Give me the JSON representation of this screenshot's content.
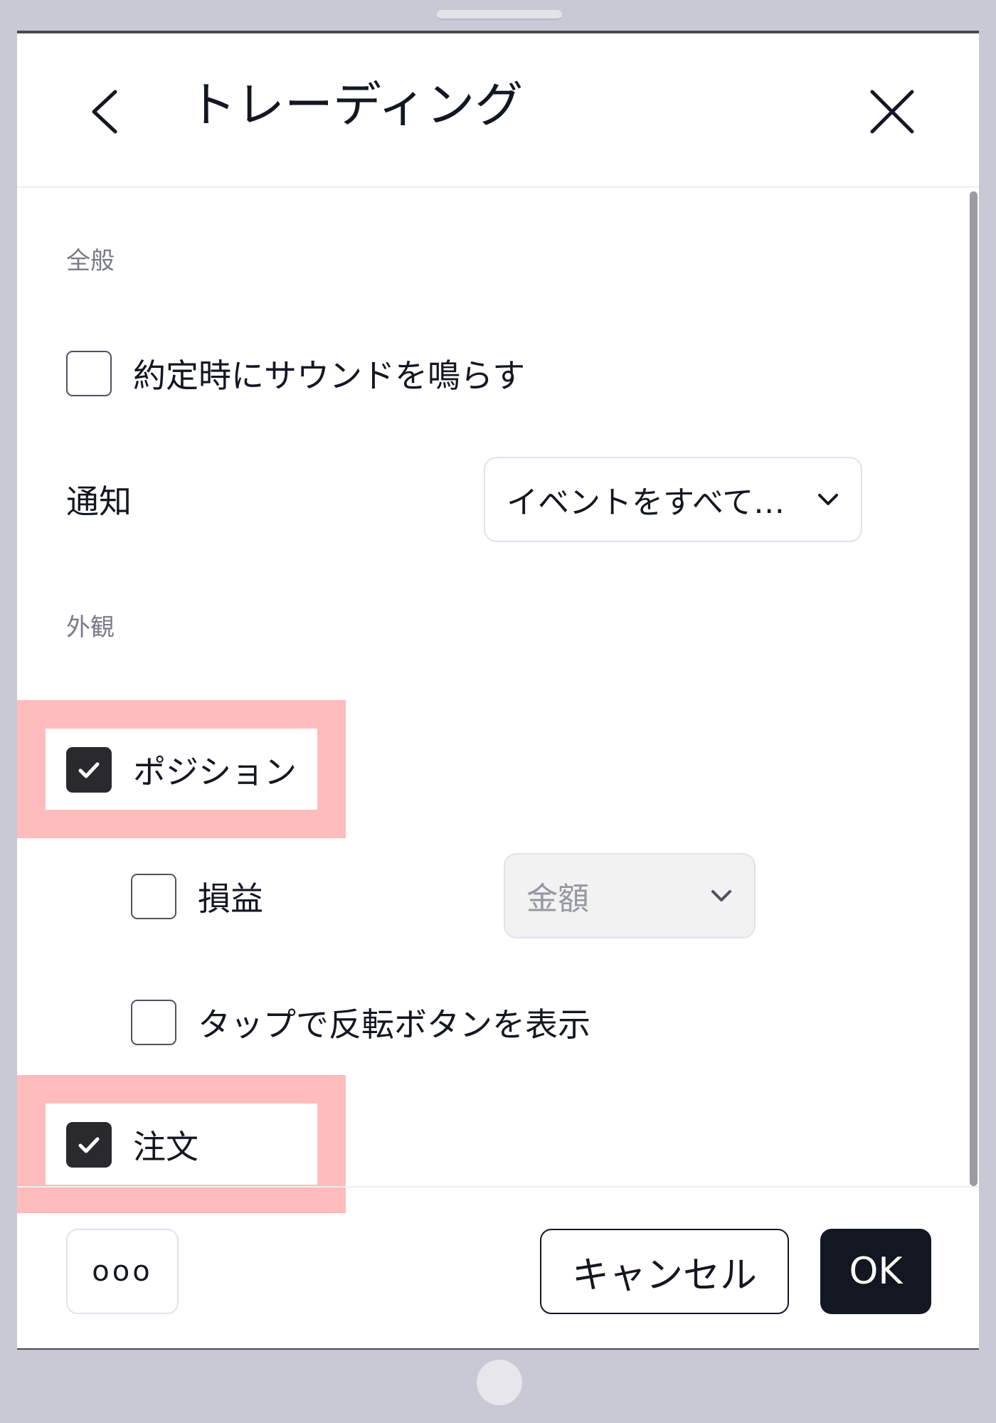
{
  "dialog": {
    "title": "トレーディング"
  },
  "general": {
    "label": "全般",
    "sound_on_fill": {
      "label": "約定時にサウンドを鳴らす",
      "checked": false
    },
    "notifications": {
      "label": "通知",
      "selected": "イベントをすべて…"
    }
  },
  "appearance": {
    "label": "外観",
    "positions": {
      "label": "ポジション",
      "checked": true
    },
    "pnl": {
      "label": "損益",
      "checked": false,
      "selected": "金額"
    },
    "reverse_button": {
      "label": "タップで反転ボタンを表示",
      "checked": false
    },
    "orders": {
      "label": "注文",
      "checked": true
    }
  },
  "footer": {
    "more_label": "ooo",
    "cancel_label": "キャンセル",
    "ok_label": "OK"
  },
  "colors": {
    "highlight": "#ffbcbc",
    "checkbox_checked": "#2a2a2e",
    "primary_button": "#131722",
    "device_frame": "#c9c9d6"
  }
}
